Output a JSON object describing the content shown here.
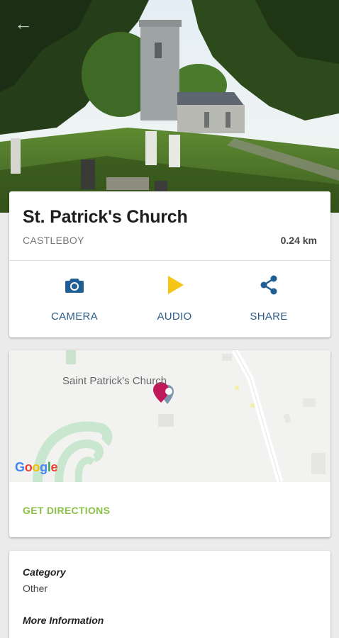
{
  "place": {
    "title": "St. Patrick's Church",
    "location": "CASTLEBOY",
    "distance": "0.24 km"
  },
  "actions": [
    {
      "label": "CAMERA",
      "icon": "camera-icon",
      "color": "#1f5f95"
    },
    {
      "label": "AUDIO",
      "icon": "play-icon",
      "color": "#f5c518"
    },
    {
      "label": "SHARE",
      "icon": "share-icon",
      "color": "#1f5f95"
    }
  ],
  "map": {
    "pin_label": "Saint Patrick's Church",
    "logo_text": "Google",
    "directions_label": "GET DIRECTIONS"
  },
  "info": {
    "category_label": "Category",
    "category_value": "Other",
    "more_label": "More Information"
  },
  "colors": {
    "accent_blue": "#2d5c8a",
    "accent_green": "#8cc04b",
    "pin_magenta": "#c0195a"
  }
}
